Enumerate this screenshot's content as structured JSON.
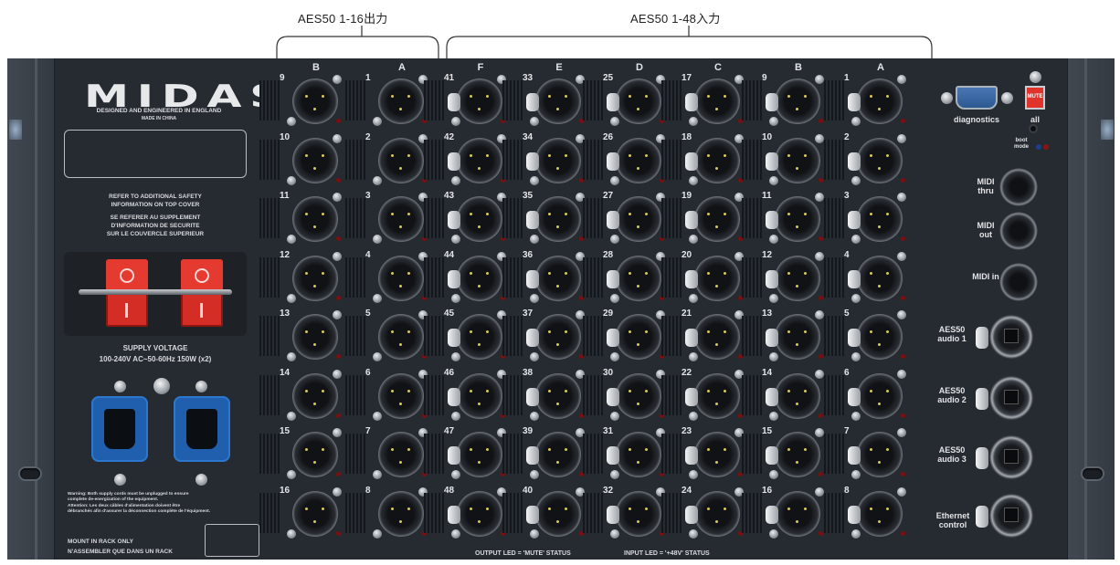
{
  "callouts": {
    "outputs": "AES50 1-16出力",
    "inputs": "AES50 1-48入力"
  },
  "panel": {
    "logo": "MIDAS",
    "tagline": "DESIGNED AND ENGINEERED IN ENGLAND",
    "made_in": "MADE IN CHINA",
    "safety_en_1": "REFER TO ADDITIONAL SAFETY",
    "safety_en_2": "INFORMATION ON TOP COVER",
    "safety_fr_1": "SE REFERER AU SUPPLEMENT",
    "safety_fr_2": "D'INFORMATION DE SECURITE",
    "safety_fr_3": "SUR LE COUVERCLE SUPERIEUR",
    "supply_title": "SUPPLY VOLTAGE",
    "supply_spec": "100-240V  AC~50-60Hz 150W (x2)",
    "warning_1": "Warning: Both supply cords must be unplugged to ensure",
    "warning_2": "complete de-energization of the equipment.",
    "warning_3": "Attention: Les deux câbles d'alimentation doivent être",
    "warning_4": "débranchés afin d'assurer la déconnection complète de l'équipment.",
    "mount_1": "MOUNT IN RACK ONLY",
    "mount_2": "N'ASSEMBLER QUE DANS UN RACK",
    "output_led_note": "OUTPUT LED = 'MUTE' STATUS",
    "input_led_note": "INPUT LED = '+48V' STATUS"
  },
  "output_columns": [
    {
      "label": "B",
      "numbers": [
        "9",
        "10",
        "11",
        "12",
        "13",
        "14",
        "15",
        "16"
      ]
    },
    {
      "label": "A",
      "numbers": [
        "1",
        "2",
        "3",
        "4",
        "5",
        "6",
        "7",
        "8"
      ]
    }
  ],
  "input_columns": [
    {
      "label": "F",
      "numbers": [
        "41",
        "42",
        "43",
        "44",
        "45",
        "46",
        "47",
        "48"
      ]
    },
    {
      "label": "E",
      "numbers": [
        "33",
        "34",
        "35",
        "36",
        "37",
        "38",
        "39",
        "40"
      ]
    },
    {
      "label": "D",
      "numbers": [
        "25",
        "26",
        "27",
        "28",
        "29",
        "30",
        "31",
        "32"
      ]
    },
    {
      "label": "C",
      "numbers": [
        "17",
        "18",
        "19",
        "20",
        "21",
        "22",
        "23",
        "24"
      ]
    },
    {
      "label": "B",
      "numbers": [
        "9",
        "10",
        "11",
        "12",
        "13",
        "14",
        "15",
        "16"
      ]
    },
    {
      "label": "A",
      "numbers": [
        "1",
        "2",
        "3",
        "4",
        "5",
        "6",
        "7",
        "8"
      ]
    }
  ],
  "side": {
    "diagnostics": "diagnostics",
    "mute_button": "MUTE",
    "mute_all": "all",
    "boot_mode": "boot mode",
    "midi_thru": "MIDI thru",
    "midi_out": "MIDI out",
    "midi_in": "MIDI in",
    "aes50_1": "AES50 audio 1",
    "aes50_2": "AES50 audio 2",
    "aes50_3": "AES50 audio 3",
    "ethernet": "Ethernet control"
  },
  "colors": {
    "panel": "#262a31",
    "switch_red": "#d32d25",
    "iec_blue": "#1f5fae",
    "led_red": "#7a1010"
  },
  "icons": [
    "xlr-connector-icon",
    "iec-power-inlet-icon",
    "power-switch-icon",
    "d-sub-port-icon",
    "midi-din-icon",
    "etherCON-rj45-icon",
    "screw-icon"
  ]
}
